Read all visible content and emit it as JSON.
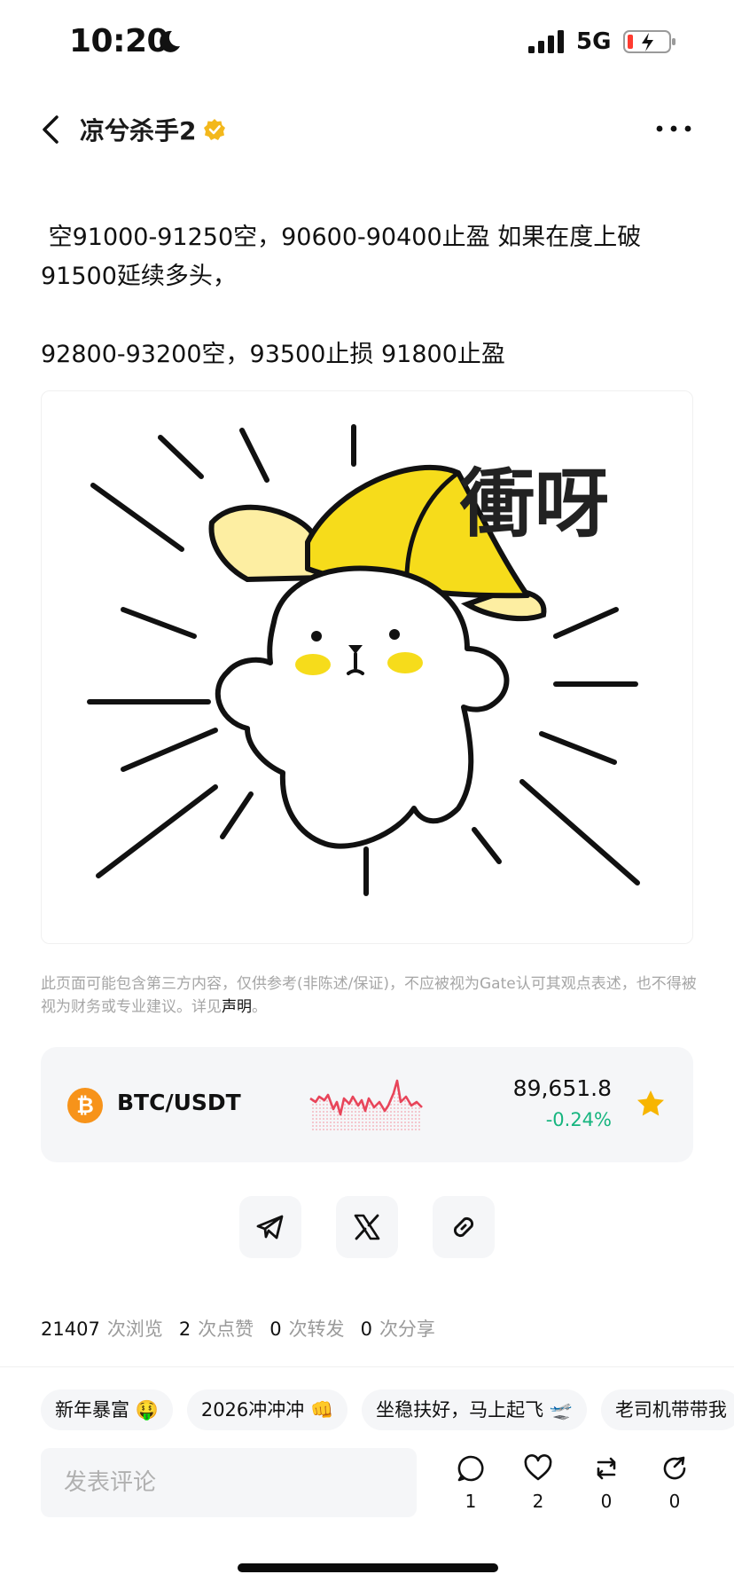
{
  "status_bar": {
    "time": "10:20",
    "network": "5G"
  },
  "header": {
    "title": "凉兮杀手2"
  },
  "post": {
    "line1": " 空91000-91250空，90600-90400止盈 如果在度上破91500延续多头，",
    "line2": "92800-93200空，93500止损 91800止盈"
  },
  "sticker": {
    "caption": "衝呀"
  },
  "disclaimer": {
    "text": "此页面可能包含第三方内容，仅供参考(非陈述/保证)，不应被视为Gate认可其观点表述，也不得被视为财务或专业建议。详见",
    "link": "声明",
    "end": "。"
  },
  "ticker": {
    "symbol_glyph": "₿",
    "pair": "BTC/USDT",
    "price": "89,651.8",
    "change": "-0.24%",
    "change_color": "#16b57f"
  },
  "stats": [
    {
      "value": "21407",
      "label": "次浏览"
    },
    {
      "value": "2",
      "label": "次点赞"
    },
    {
      "value": "0",
      "label": "次转发"
    },
    {
      "value": "0",
      "label": "次分享"
    }
  ],
  "tags": [
    "新年暴富 🤑",
    "2026冲冲冲 👊",
    "坐稳扶好，马上起飞 🛫",
    "老司机带带我"
  ],
  "comment": {
    "placeholder": "发表评论"
  },
  "actions": [
    {
      "icon": "comment-icon",
      "count": "1"
    },
    {
      "icon": "heart-icon",
      "count": "2"
    },
    {
      "icon": "repost-icon",
      "count": "0"
    },
    {
      "icon": "share-icon",
      "count": "0"
    }
  ],
  "colors": {
    "accent_green": "#16b57f",
    "btc_orange": "#f7931a",
    "star_gold": "#f7b500",
    "sparkline_red": "#e8455a"
  }
}
